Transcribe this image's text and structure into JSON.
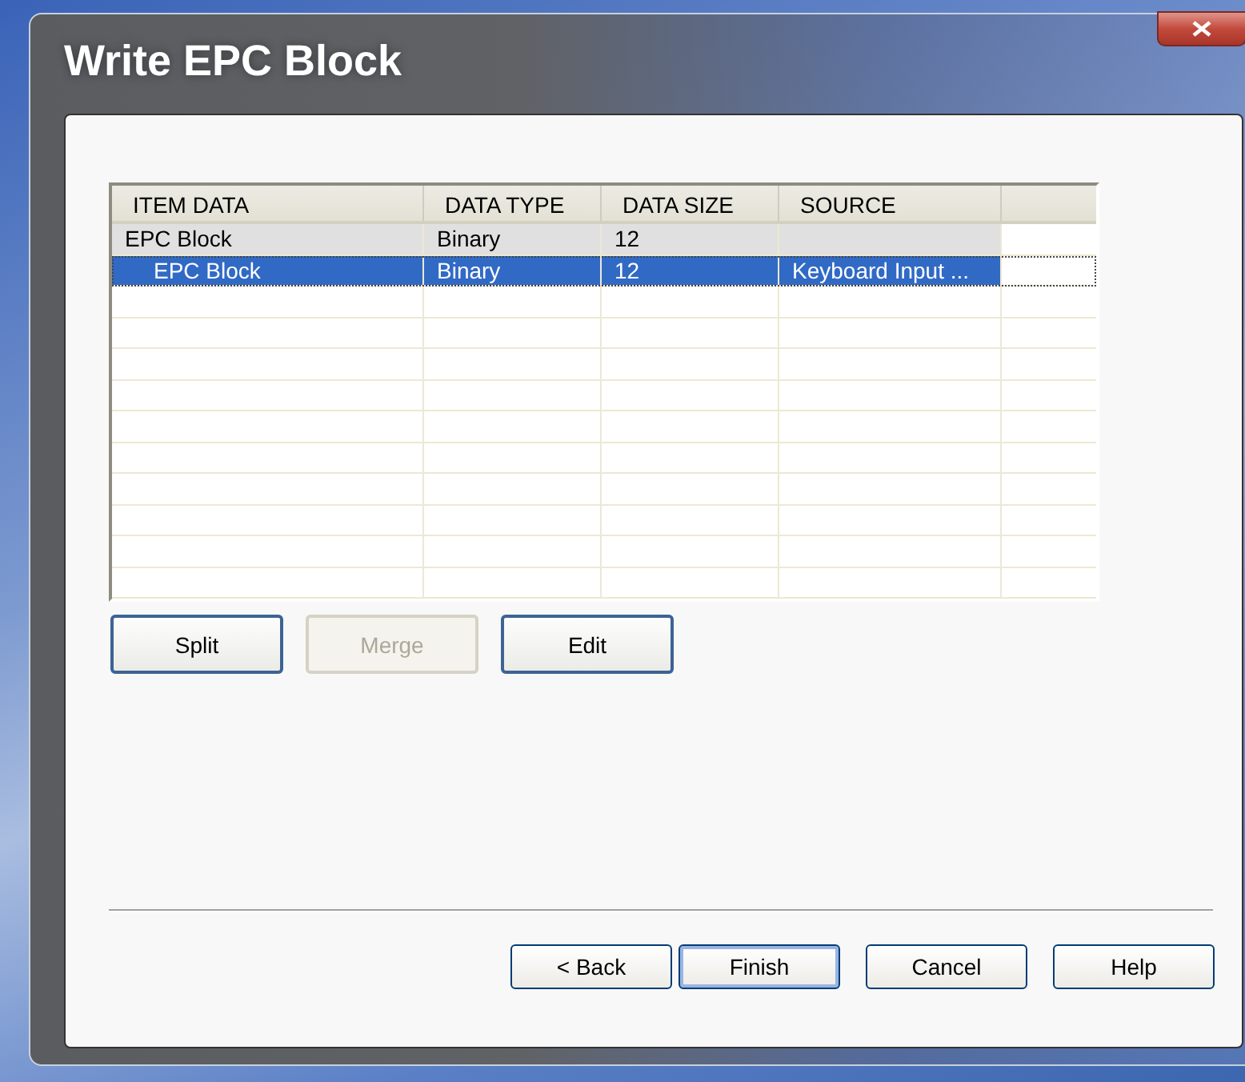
{
  "window": {
    "title": "Write EPC Block"
  },
  "table": {
    "columns": [
      "ITEM DATA",
      "DATA TYPE",
      "DATA SIZE",
      "SOURCE"
    ],
    "rows": [
      {
        "cells": [
          "EPC Block",
          "Binary",
          "12",
          ""
        ],
        "selected": false,
        "children": [
          {
            "cells": [
              "EPC Block",
              "Binary",
              "12",
              "Keyboard Input ..."
            ],
            "selected": true
          }
        ]
      }
    ]
  },
  "row_buttons": [
    {
      "label": "Split",
      "disabled": false
    },
    {
      "label": "Merge",
      "disabled": true
    },
    {
      "label": "Edit",
      "disabled": false
    }
  ],
  "footer_buttons": [
    {
      "label": "< Back",
      "default": false
    },
    {
      "label": "Finish",
      "default": true
    },
    {
      "label": "Cancel",
      "default": false
    },
    {
      "label": "Help",
      "default": false
    }
  ]
}
